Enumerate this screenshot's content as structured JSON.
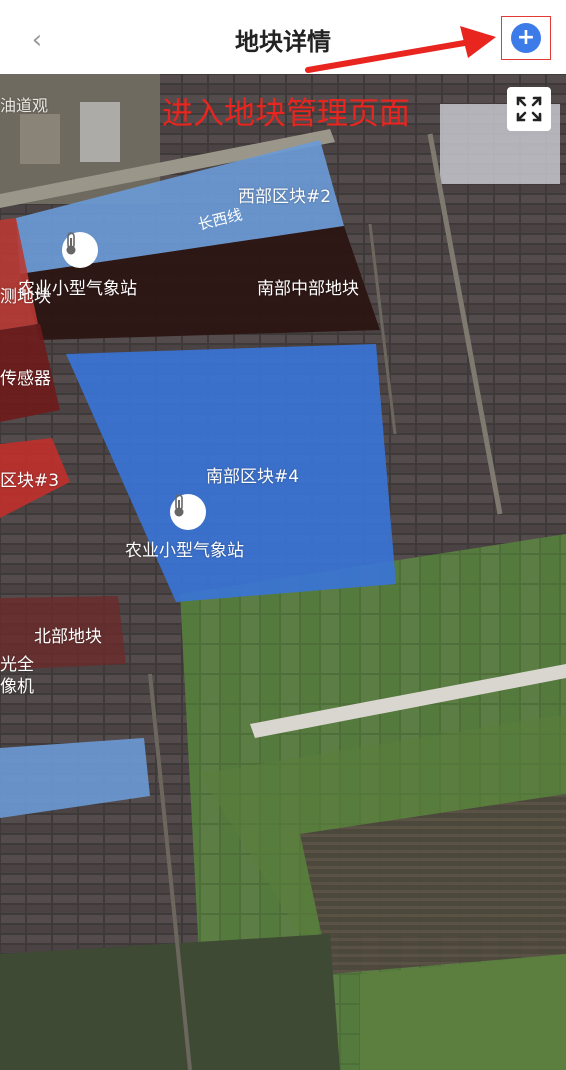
{
  "header": {
    "title": "地块详情",
    "back_icon": "chevron-left-icon",
    "add_icon": "plus-icon"
  },
  "annotation": {
    "text": "进入地块管理页面",
    "color": "#e8251f"
  },
  "map": {
    "road_label": "长西线",
    "plots": [
      {
        "label": "西部区块#2",
        "color": "#6a9ad6"
      },
      {
        "label": "南部中部地块",
        "color": "#2b1513"
      },
      {
        "label": "南部区块#4",
        "color": "#3a74d6"
      },
      {
        "label": "北部地块",
        "color": "#6b2a2a"
      },
      {
        "label": "区块#3",
        "color": "#c0302c"
      },
      {
        "label": "测地块",
        "color": "#b83a33"
      },
      {
        "label": "传感器",
        "color": "#6e1b1b"
      }
    ],
    "devices": [
      {
        "label": "农业小型气象站"
      },
      {
        "label": "农业小型气象站"
      },
      {
        "label_line1": "光全",
        "label_line2": "像机"
      }
    ],
    "top_left_text": "油道观"
  }
}
